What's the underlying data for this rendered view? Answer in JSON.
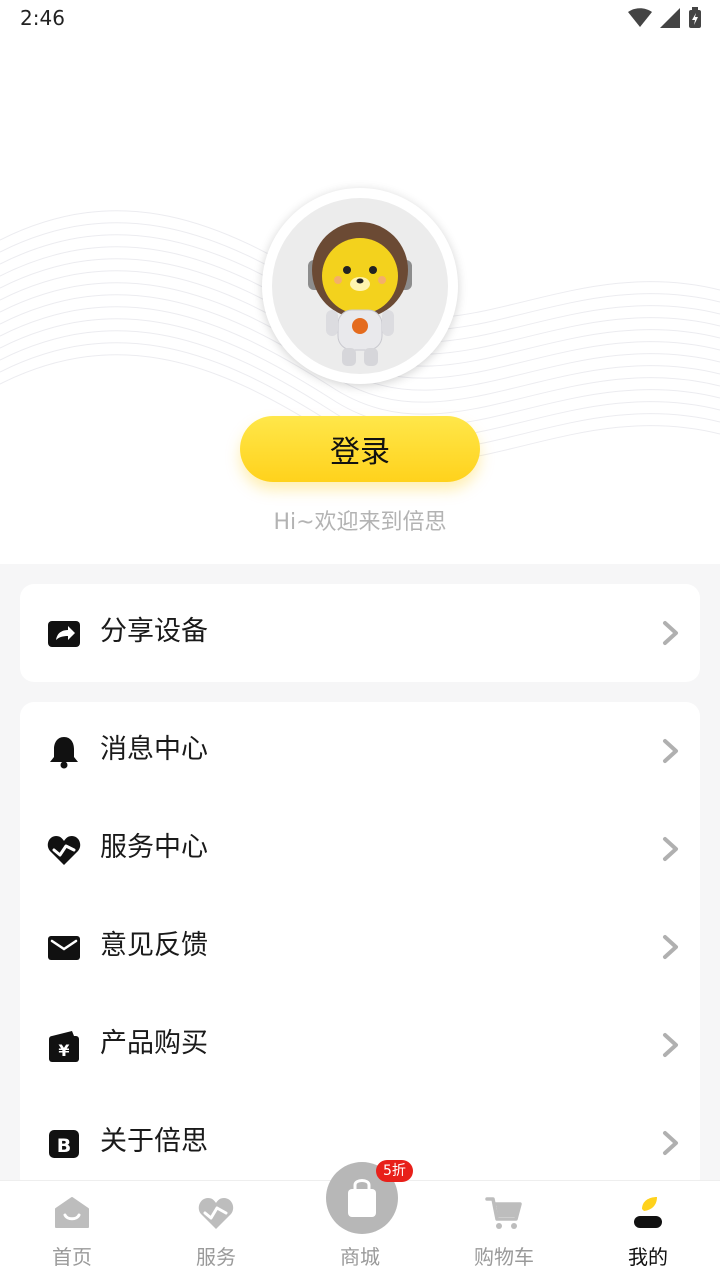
{
  "status_bar": {
    "time": "2:46"
  },
  "profile": {
    "login_label": "登录",
    "welcome_text": "Hi~欢迎来到倍思"
  },
  "menu": {
    "share": {
      "label": "分享设备",
      "icon": "share-icon"
    },
    "items": [
      {
        "label": "消息中心",
        "icon": "bell-icon"
      },
      {
        "label": "服务中心",
        "icon": "heart-service-icon"
      },
      {
        "label": "意见反馈",
        "icon": "mail-icon"
      },
      {
        "label": "产品购买",
        "icon": "wallet-yen-icon"
      },
      {
        "label": "关于倍思",
        "icon": "brand-b-icon"
      }
    ]
  },
  "tabbar": {
    "tabs": [
      {
        "label": "首页",
        "icon": "home-icon"
      },
      {
        "label": "服务",
        "icon": "service-icon"
      },
      {
        "label": "商城",
        "icon": "shopping-bag-icon"
      },
      {
        "label": "购物车",
        "icon": "cart-icon"
      },
      {
        "label": "我的",
        "icon": "profile-icon"
      }
    ],
    "active": "我的",
    "mall_badge": "5折"
  },
  "colors": {
    "accent": "#ffd21c",
    "badge": "#e8201a",
    "text": "#1a1a1a",
    "muted": "#9a9a9a"
  }
}
